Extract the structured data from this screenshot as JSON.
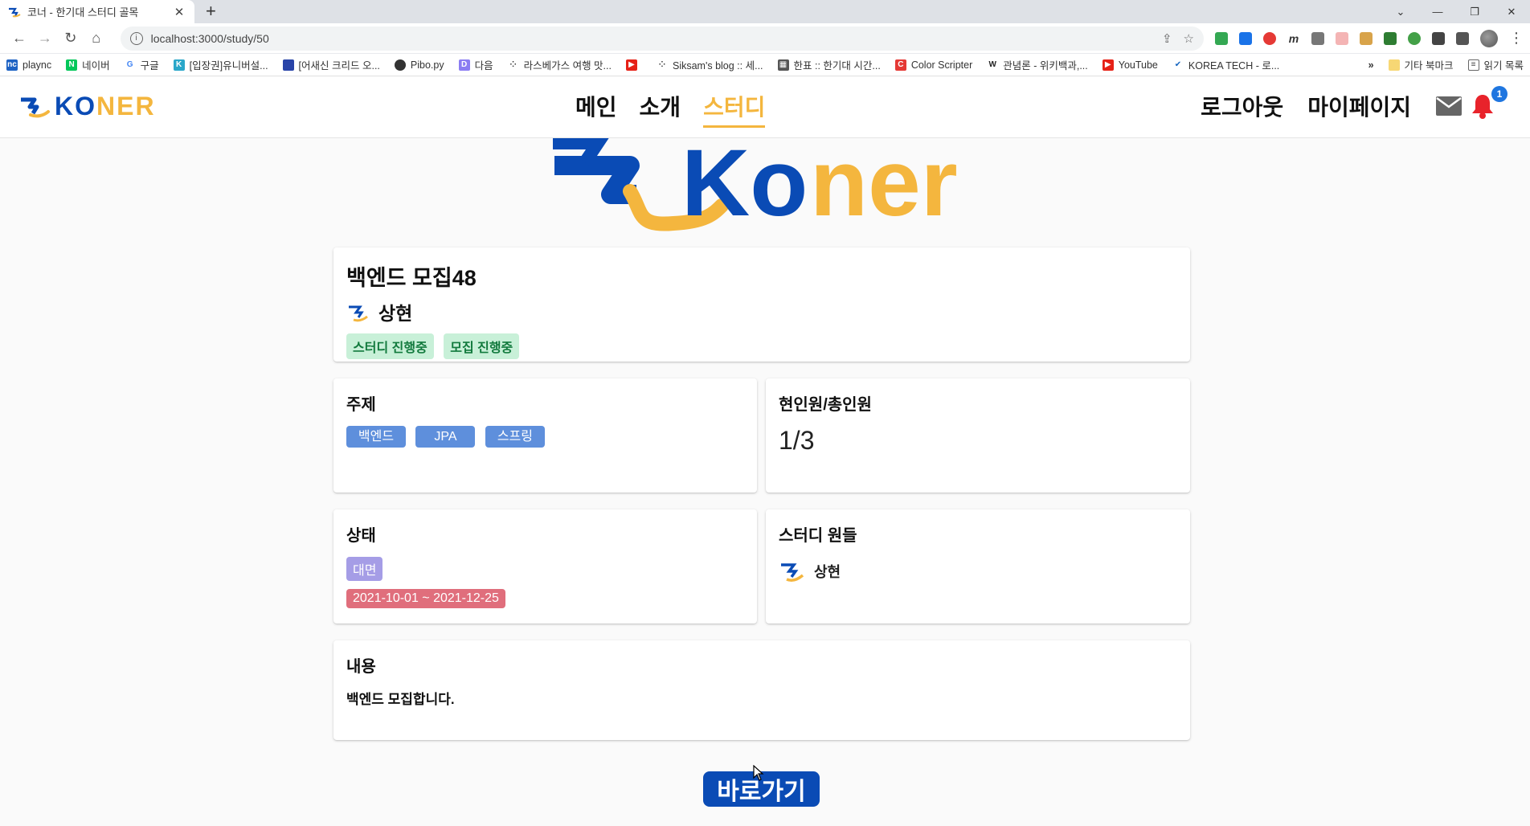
{
  "browser": {
    "tab_title": "코너 - 한기대 스터디 골목",
    "url": "localhost:3000/study/50",
    "bookmarks": [
      "plaync",
      "네이버",
      "구글",
      "[입장권]유니버설...",
      "[어새신 크리드 오...",
      "Pibo.py",
      "다음",
      "라스베가스 여행 맛...",
      "Siksam's blog :: 세...",
      "한표 :: 한기대 시간...",
      "Color Scripter",
      "관념론 - 위키백과,...",
      "YouTube",
      "KOREA TECH - 로..."
    ],
    "bookmarks_more": "»",
    "other_bookmarks": "기타 북마크",
    "reading_list": "읽기 목록"
  },
  "header": {
    "logo_ko": "KO",
    "logo_ner": "NER",
    "nav": [
      "메인",
      "소개",
      "스터디"
    ],
    "active_nav": "스터디",
    "logout": "로그아웃",
    "mypage": "마이페이지",
    "notification_count": "1"
  },
  "hero": {
    "text_ko": "Ko",
    "text_ner": "ner"
  },
  "study": {
    "title": "백엔드 모집48",
    "owner": "상현",
    "status_chips": [
      "스터디 진행중",
      "모집 진행중"
    ]
  },
  "topic": {
    "heading": "주제",
    "tags": [
      "백엔드",
      "JPA",
      "스프링"
    ]
  },
  "members_count": {
    "heading": "현인원/총인원",
    "value": "1/3"
  },
  "state": {
    "heading": "상태",
    "mode": "대면",
    "period": "2021-10-01 ~ 2021-12-25"
  },
  "study_members": {
    "heading": "스터디 원들",
    "members": [
      "상현"
    ]
  },
  "content": {
    "heading": "내용",
    "text": "백엔드 모집합니다."
  },
  "go_button": "바로가기",
  "colors": {
    "brand_blue": "#0a4bb5",
    "brand_yellow": "#f4b63e",
    "tag_blue": "#5e8fdc",
    "status_green": "#c8f0d8",
    "mode_purple": "#a59de6",
    "period_red": "#e06e7c"
  }
}
